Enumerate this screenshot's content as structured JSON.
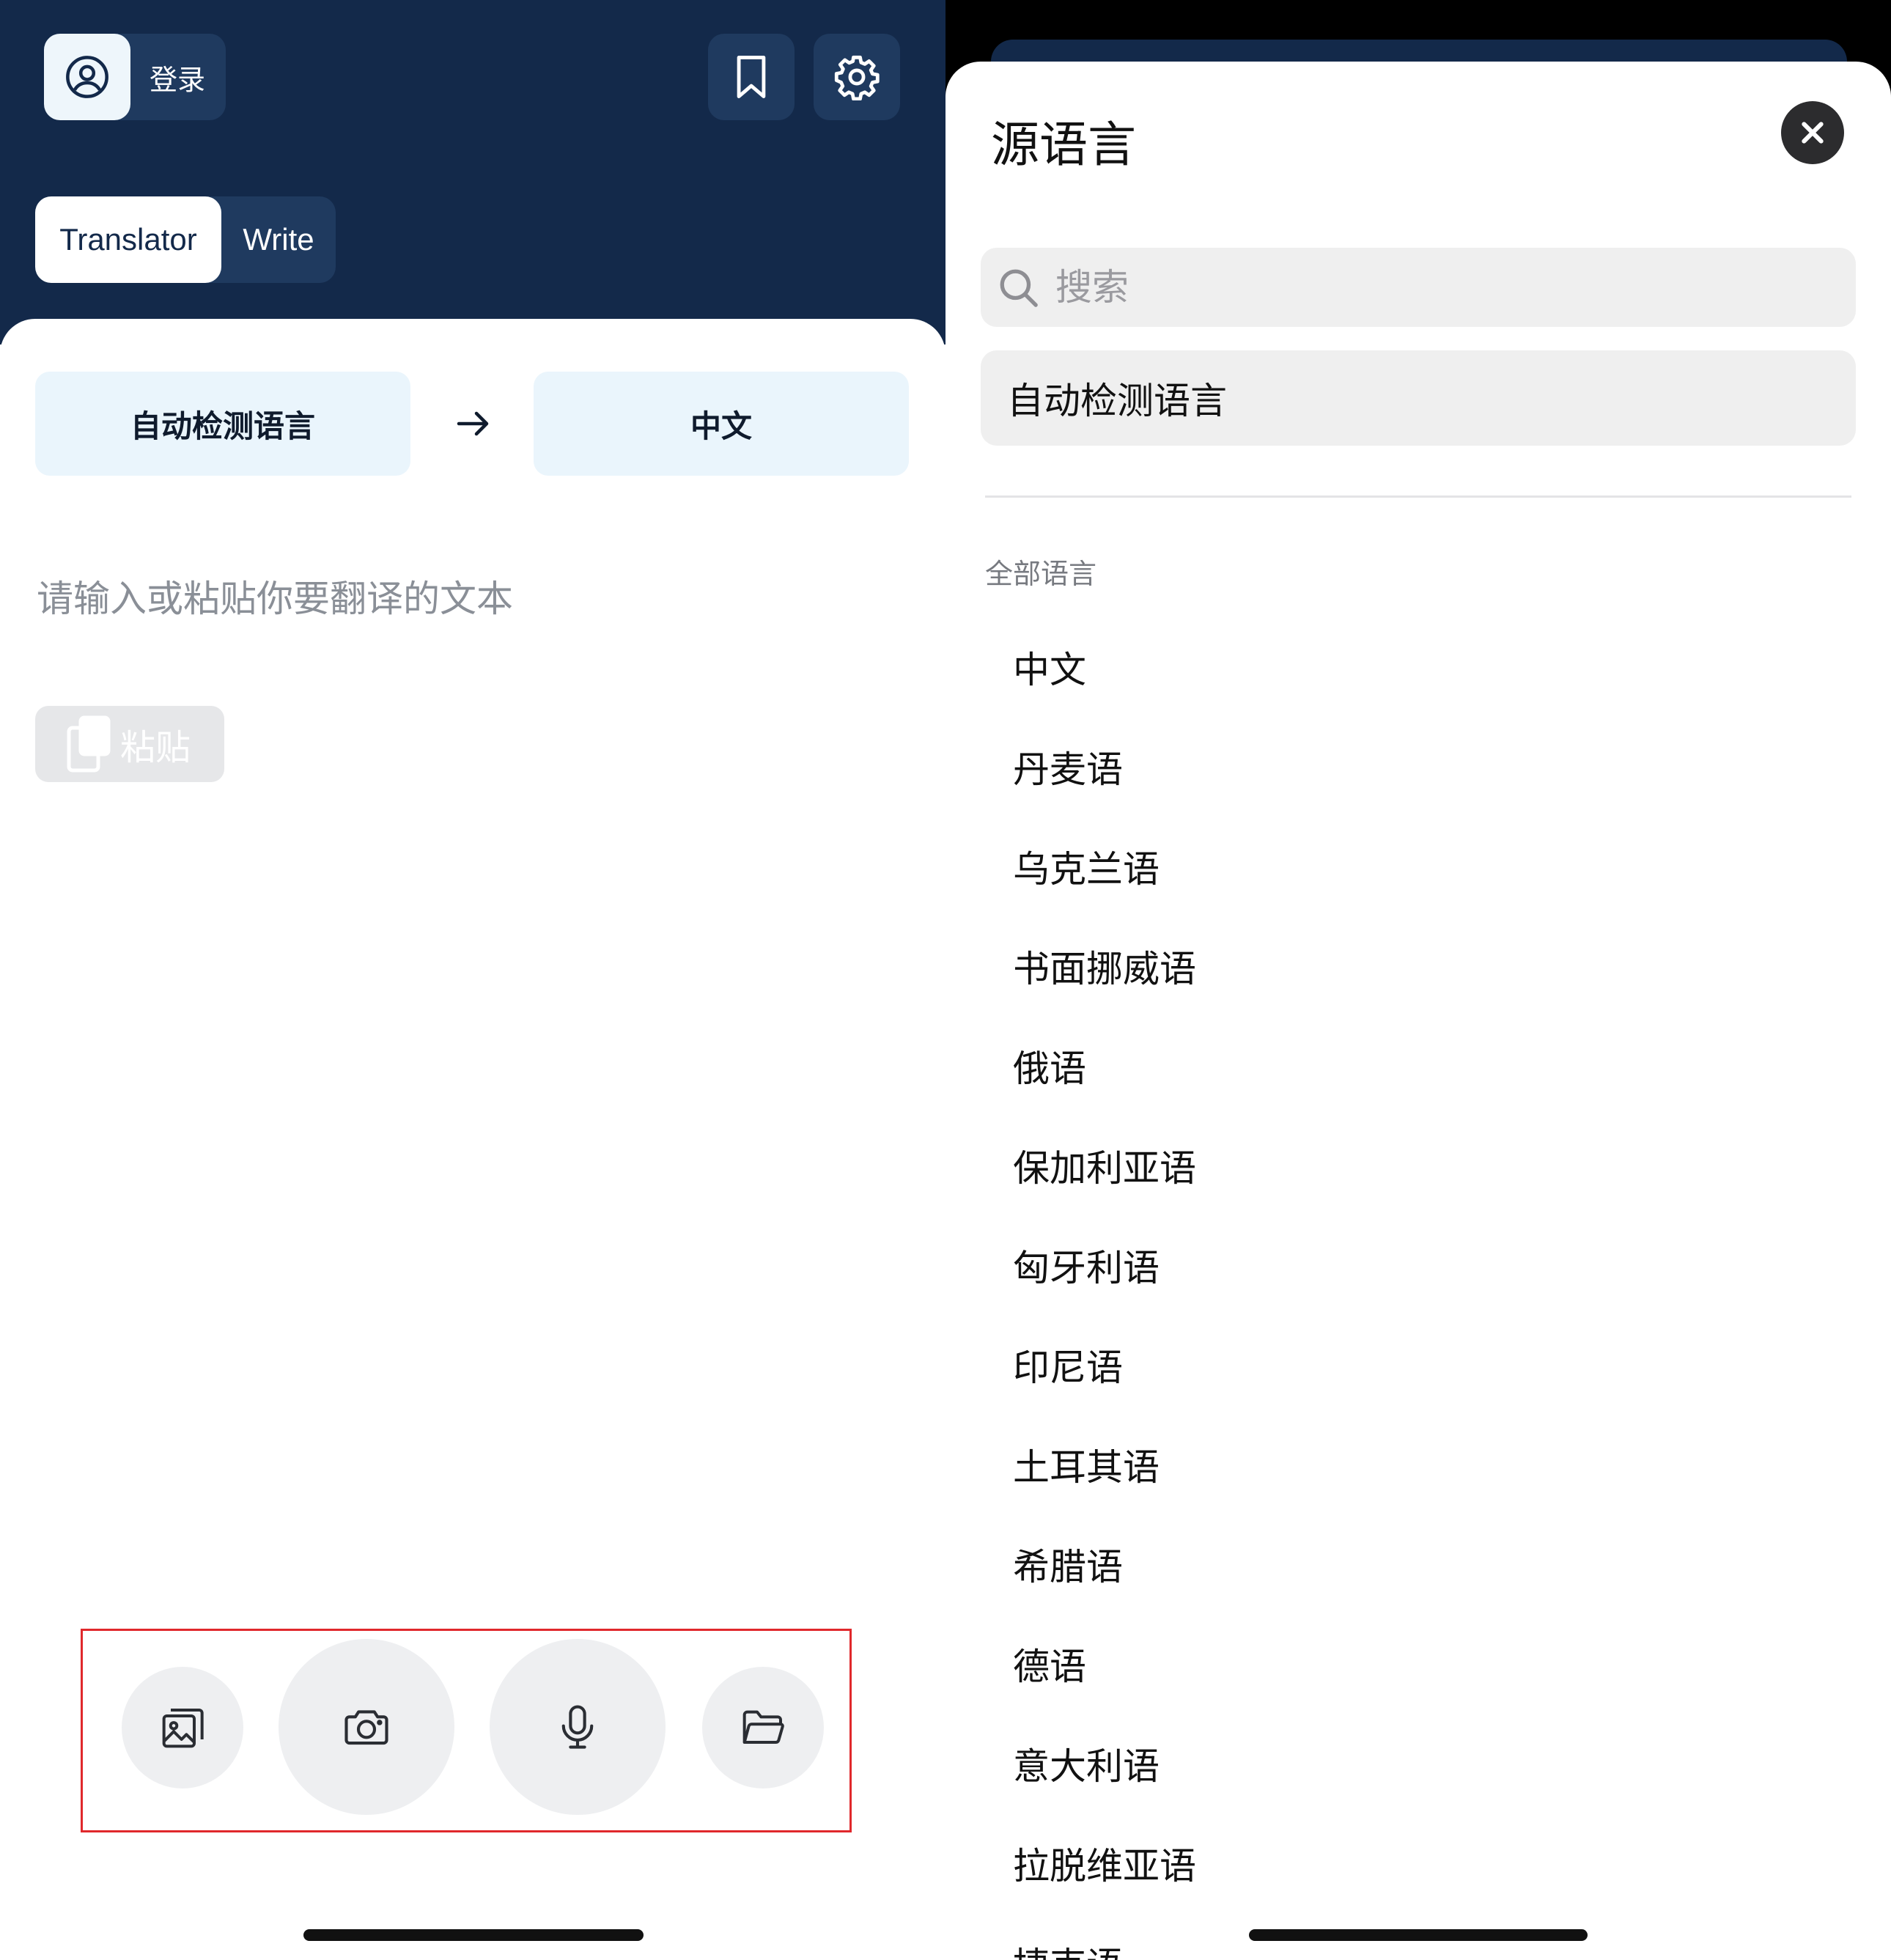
{
  "left": {
    "login_label": "登录",
    "tabs": [
      {
        "label": "Translator",
        "active": true
      },
      {
        "label": "Write",
        "active": false
      }
    ],
    "source_lang": "自动检测语言",
    "target_lang": "中文",
    "input_placeholder": "请输入或粘贴你要翻译的文本",
    "paste_label": "粘贴",
    "toolbar_icons": [
      "image-icon",
      "camera-icon",
      "microphone-icon",
      "folder-icon"
    ],
    "colors": {
      "header": "#13294a",
      "lang_button": "#eaf5fc",
      "highlight_frame": "#e0282c"
    }
  },
  "right": {
    "title": "源语言",
    "search_placeholder": "搜索",
    "auto_detect": "自动检测语言",
    "section_label": "全部语言",
    "languages": [
      "中文",
      "丹麦语",
      "乌克兰语",
      "书面挪威语",
      "俄语",
      "保加利亚语",
      "匈牙利语",
      "印尼语",
      "土耳其语",
      "希腊语",
      "德语",
      "意大利语",
      "拉脱维亚语",
      "捷克语"
    ]
  }
}
